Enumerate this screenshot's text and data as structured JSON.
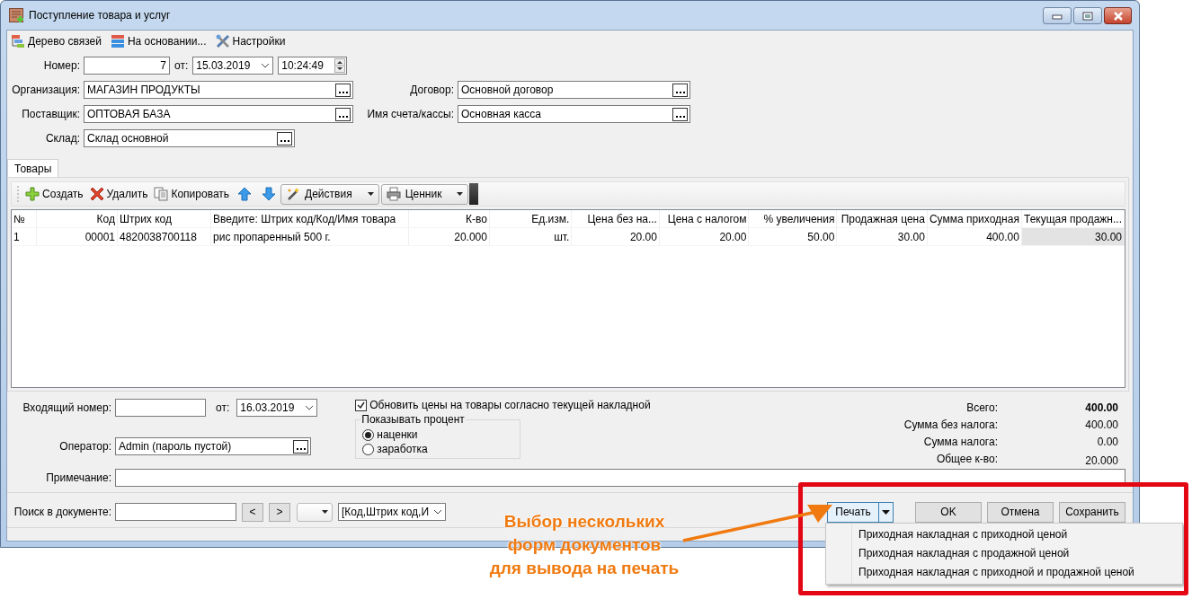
{
  "window": {
    "title": "Поступление товара и услуг"
  },
  "toolbar": [
    {
      "label": "Дерево связей"
    },
    {
      "label": "На основании..."
    },
    {
      "label": "Настройки"
    }
  ],
  "header": {
    "number": {
      "label": "Номер:",
      "value": "7"
    },
    "date": {
      "label": "от:",
      "value": "15.03.2019"
    },
    "time": {
      "value": "10:24:49"
    },
    "organization": {
      "label": "Организация:",
      "value": "МАГАЗИН ПРОДУКТЫ"
    },
    "contract": {
      "label": "Договор:",
      "value": "Основной договор"
    },
    "supplier": {
      "label": "Поставщик:",
      "value": "ОПТОВАЯ БАЗА"
    },
    "account": {
      "label": "Имя счета/кассы:",
      "value": "Основная касса"
    },
    "warehouse": {
      "label": "Склад:",
      "value": "Склад основной"
    }
  },
  "tabs": [
    {
      "label": "Товары",
      "selected": true
    }
  ],
  "grid_toolbar": [
    {
      "kind": "button",
      "label": "Создать"
    },
    {
      "kind": "button",
      "label": "Удалить"
    },
    {
      "kind": "button",
      "label": "Копировать"
    },
    {
      "kind": "icon"
    },
    {
      "kind": "icon"
    },
    {
      "kind": "dropdown",
      "label": "Действия"
    },
    {
      "kind": "dropdown",
      "label": "Ценник"
    }
  ],
  "table": {
    "columns": [
      {
        "label": "№",
        "kind": "text",
        "readonly": false
      },
      {
        "label": "Код",
        "kind": "number",
        "readonly": false
      },
      {
        "label": "Штрих код",
        "kind": "text",
        "readonly": false
      },
      {
        "label": "Введите: Штрих код/Код/Имя товара",
        "kind": "text",
        "readonly": false
      },
      {
        "label": "К-во",
        "kind": "number",
        "readonly": false
      },
      {
        "label": "Ед.изм.",
        "kind": "number",
        "readonly": false
      },
      {
        "label": "Цена без на...",
        "kind": "number",
        "readonly": false
      },
      {
        "label": "Цена с налогом",
        "kind": "number",
        "readonly": false
      },
      {
        "label": "% увеличения",
        "kind": "number",
        "readonly": false
      },
      {
        "label": "Продажная цена",
        "kind": "number",
        "readonly": false
      },
      {
        "label": "Сумма приходная",
        "kind": "number",
        "readonly": false
      },
      {
        "label": "Текущая продажн...",
        "kind": "number",
        "readonly": true
      }
    ],
    "rows": [
      {
        "cells": [
          "1",
          "00001",
          "4820038700118",
          "рис пропаренный 500 г.",
          "20.000",
          "шт.",
          "20.00",
          "20.00",
          "50.00",
          "30.00",
          "400.00",
          "30.00"
        ]
      }
    ]
  },
  "footer": {
    "incoming_number": {
      "label": "Входящий номер:"
    },
    "incoming_date": {
      "label": "от:",
      "value": "16.03.2019"
    },
    "operator": {
      "label": "Оператор:",
      "value": "Admin (пароль пустой)"
    },
    "note": {
      "label": "Примечание:"
    },
    "update_prices": {
      "label": "Обновить цены на товары согласно текущей накладной",
      "checked": true
    },
    "percent_group": {
      "title": "Показывать процент",
      "options": [
        {
          "label": "наценки",
          "selected": true
        },
        {
          "label": "заработка",
          "selected": false
        }
      ]
    },
    "totals": [
      {
        "label": "Всего:",
        "value": "400.00",
        "bold": true
      },
      {
        "label": "Сумма без налога:",
        "value": "400.00",
        "bold": false
      },
      {
        "label": "Сумма налога:",
        "value": "0.00",
        "bold": false
      },
      {
        "label": "Общее к-во:",
        "value": "20.000",
        "bold": false
      }
    ]
  },
  "search": {
    "label": "Поиск в документе:",
    "prev": "<",
    "next": ">",
    "filter": "[Код,Штрих код,И"
  },
  "buttons": {
    "print": "Печать",
    "ok": "OK",
    "cancel": "Отмена",
    "save": "Сохранить"
  },
  "print_menu": [
    {
      "label": "Приходная накладная с приходной ценой"
    },
    {
      "label": "Приходная накладная с продажной ценой"
    },
    {
      "label": "Приходная накладная с приходной и продажной ценой"
    }
  ],
  "annotation": {
    "text": "Выбор нескольких\nформ документов\nдля вывода на печать"
  }
}
